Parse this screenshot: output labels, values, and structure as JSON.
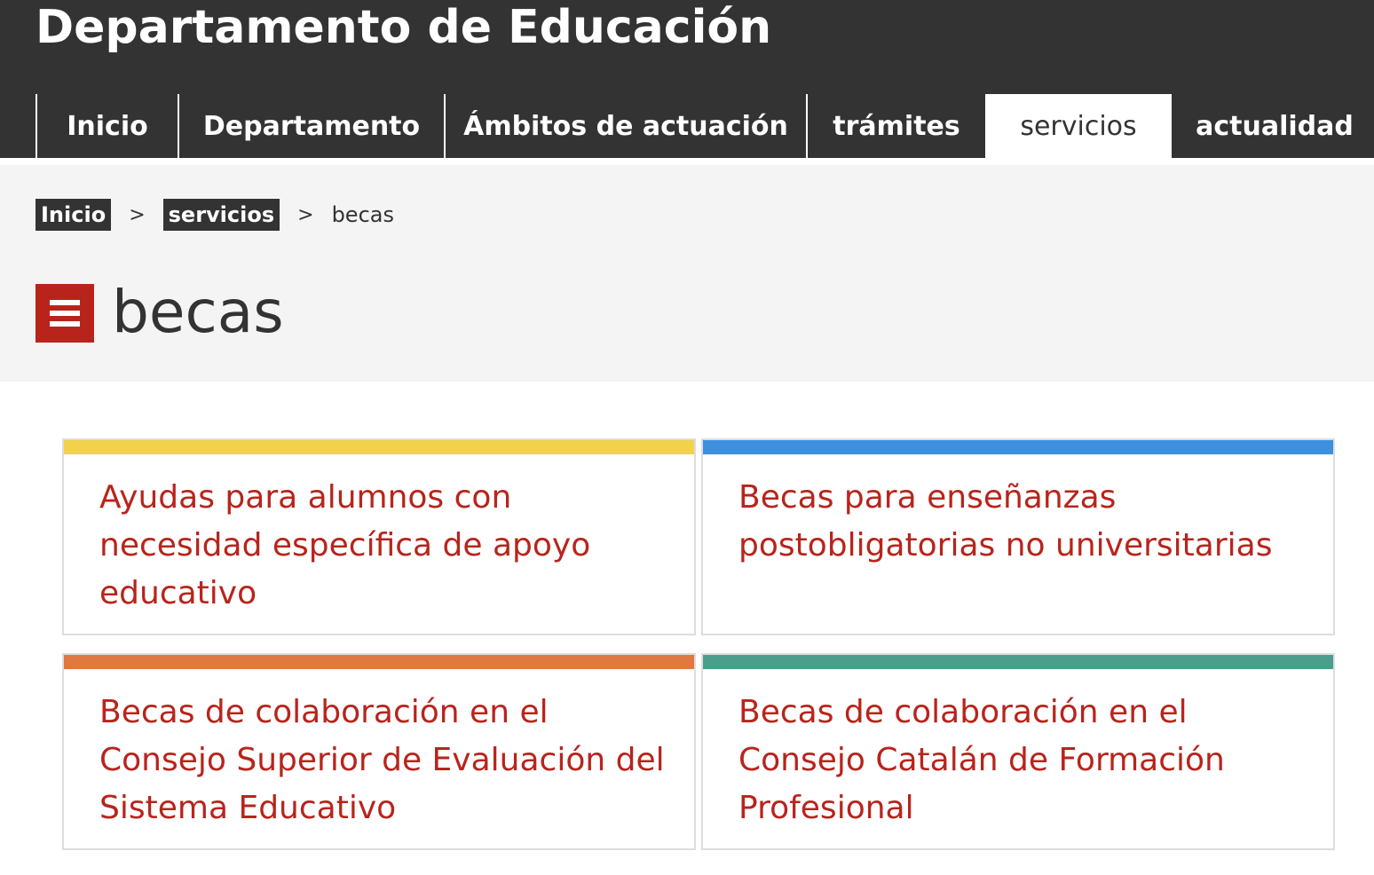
{
  "site_title": "Departamento de Educación",
  "nav": {
    "items": [
      {
        "label": "Inicio"
      },
      {
        "label": "Departamento"
      },
      {
        "label": "Ámbitos de actuación"
      },
      {
        "label": "trámites"
      },
      {
        "label": "servicios",
        "active": true
      },
      {
        "label": "actualidad"
      }
    ]
  },
  "breadcrumb": {
    "items": [
      "Inicio",
      "servicios"
    ],
    "separator": ">",
    "current": "becas"
  },
  "page": {
    "title": "becas",
    "icon": "menu-lines-icon",
    "icon_color": "#b8241c"
  },
  "cards": [
    {
      "title": "Ayudas para alumnos con necesidad específica de apoyo educativo",
      "accent": "#f2d24b"
    },
    {
      "title": "Becas para enseñanzas postobligatorias no universitarias",
      "accent": "#3d8fe0"
    },
    {
      "title": "Becas de colaboración en el Consejo Superior de Evaluación del Sistema Educativo",
      "accent": "#e07840"
    },
    {
      "title": "Becas de colaboración en el Consejo Catalán de Formación Profesional",
      "accent": "#4a9e8c"
    }
  ],
  "colors": {
    "header_bg": "#333333",
    "link_red": "#b8241c",
    "band_bg": "#f4f4f4"
  }
}
